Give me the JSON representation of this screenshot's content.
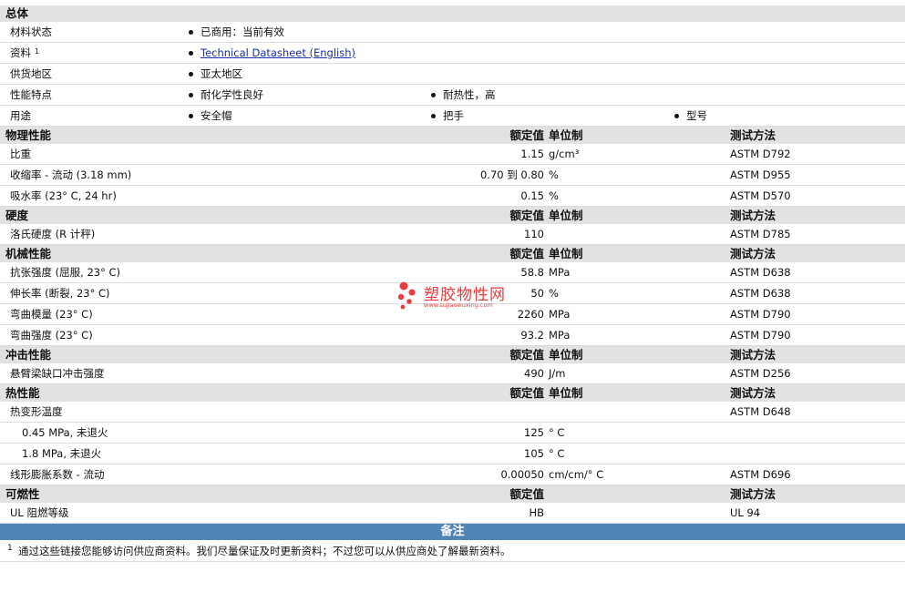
{
  "general": {
    "header": "总体",
    "rows": [
      {
        "label": "材料状态",
        "bullets": [
          "已商用：当前有效"
        ]
      },
      {
        "label": "资料",
        "sup": "1",
        "link": "Technical Datasheet (English)"
      },
      {
        "label": "供货地区",
        "bullets": [
          "亚太地区"
        ]
      },
      {
        "label": "性能特点",
        "bullets": [
          "耐化学性良好",
          "耐热性，高"
        ]
      },
      {
        "label": "用途",
        "bullets": [
          "安全帽",
          "把手",
          "型号"
        ]
      }
    ]
  },
  "sections": [
    {
      "title": "物理性能",
      "h_value": "额定值",
      "h_unit": "单位制",
      "h_method": "测试方法",
      "rows": [
        {
          "label": "比重",
          "value": "1.15",
          "unit": "g/cm³",
          "method": "ASTM D792"
        },
        {
          "label": "收缩率 - 流动 (3.18 mm)",
          "value": "0.70 到  0.80",
          "unit": "%",
          "method": "ASTM D955"
        },
        {
          "label": "吸水率 (23° C, 24 hr)",
          "value": "0.15",
          "unit": "%",
          "method": "ASTM D570"
        }
      ]
    },
    {
      "title": "硬度",
      "h_value": "额定值",
      "h_unit": "单位制",
      "h_method": "测试方法",
      "rows": [
        {
          "label": "洛氏硬度 (R 计秤)",
          "value": "110",
          "unit": "",
          "method": "ASTM D785"
        }
      ]
    },
    {
      "title": "机械性能",
      "h_value": "额定值",
      "h_unit": "单位制",
      "h_method": "测试方法",
      "rows": [
        {
          "label": "抗张强度 (屈服, 23° C)",
          "value": "58.8",
          "unit": "MPa",
          "method": "ASTM D638"
        },
        {
          "label": "伸长率 (断裂, 23° C)",
          "value": "50",
          "unit": "%",
          "method": "ASTM D638"
        },
        {
          "label": "弯曲模量 (23° C)",
          "value": "2260",
          "unit": "MPa",
          "method": "ASTM D790"
        },
        {
          "label": "弯曲强度 (23° C)",
          "value": "93.2",
          "unit": "MPa",
          "method": "ASTM D790"
        }
      ]
    },
    {
      "title": "冲击性能",
      "h_value": "额定值",
      "h_unit": "单位制",
      "h_method": "测试方法",
      "rows": [
        {
          "label": "悬臂梁缺口冲击强度",
          "value": "490",
          "unit": "J/m",
          "method": "ASTM D256"
        }
      ]
    },
    {
      "title": "热性能",
      "h_value": "额定值",
      "h_unit": "单位制",
      "h_method": "测试方法",
      "rows": [
        {
          "label": "热变形温度",
          "value": "",
          "unit": "",
          "method": "ASTM D648"
        },
        {
          "label": "0.45 MPa, 未退火",
          "sub": true,
          "value": "125",
          "unit": "° C",
          "method": ""
        },
        {
          "label": "1.8 MPa, 未退火",
          "sub": true,
          "value": "105",
          "unit": "° C",
          "method": ""
        },
        {
          "label": "线形膨胀系数 - 流动",
          "value": "0.00050",
          "unit": "cm/cm/° C",
          "method": "ASTM D696"
        }
      ]
    },
    {
      "title": "可燃性",
      "h_value": "额定值",
      "h_unit": "",
      "h_method": "测试方法",
      "rows": [
        {
          "label": "UL 阻燃等级",
          "value": "HB",
          "unit": "",
          "method": "UL 94"
        }
      ]
    }
  ],
  "notes": {
    "header": "备注",
    "footnote_num": "1",
    "footnote": "通过这些链接您能够访问供应商资料。我们尽量保证及时更新资料；不过您可以从供应商处了解最新资料。"
  },
  "watermark": {
    "name": "塑胶物性网",
    "url": "www.sujiaowuxing.com"
  },
  "colors": {
    "section_bg": "#e2e2e2",
    "notes_bar": "#4f86b7",
    "link": "#1a32a8",
    "watermark": "#e8282b"
  }
}
